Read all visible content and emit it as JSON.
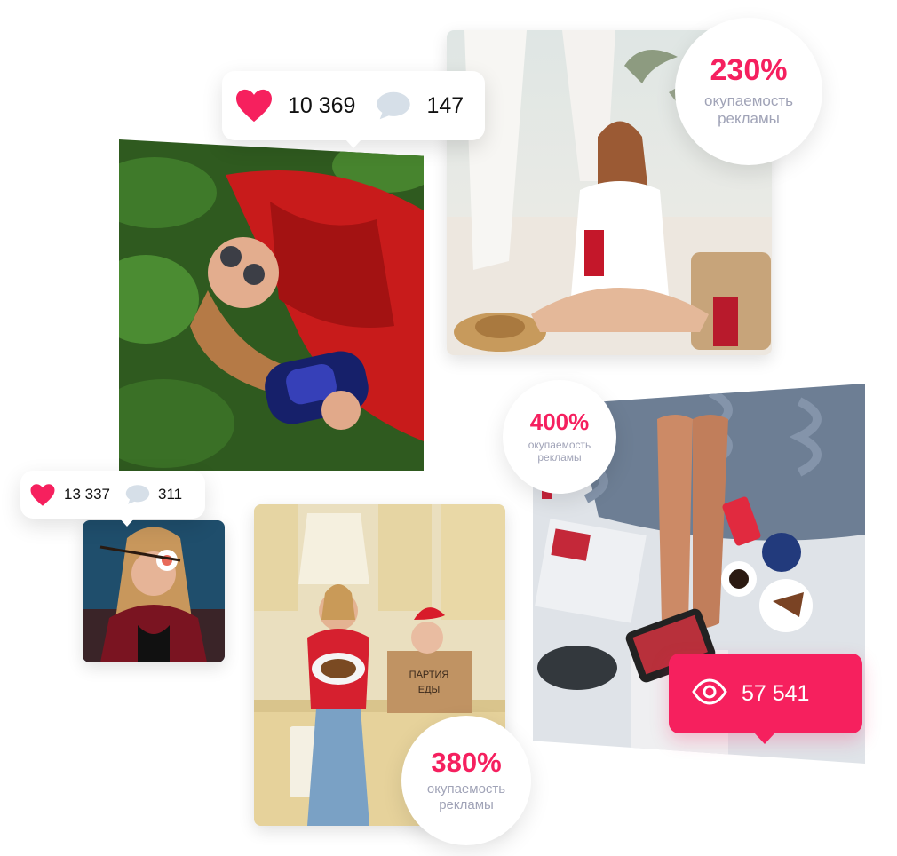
{
  "photos": {
    "beach": "beach-girl-photo",
    "grass": "red-shirt-girl-photo",
    "bed": "legs-on-bed-photo",
    "kitchen": "kitchen-woman-photo",
    "sushi": "sushi-girl-photo"
  },
  "stats_large": {
    "likes": "10 369",
    "comments": "147"
  },
  "stats_small": {
    "likes": "13 337",
    "comments": "311"
  },
  "roi": [
    {
      "value": "230%",
      "label": "окупаемость рекламы"
    },
    {
      "value": "400%",
      "label": "окупаемость рекламы"
    },
    {
      "value": "380%",
      "label": "окупаемость рекламы"
    }
  ],
  "views": {
    "count": "57 541"
  },
  "colors": {
    "accent": "#f6205e",
    "muted": "#a0a3b7",
    "comment_icon": "#d6dfe8"
  },
  "icons": {
    "like": "heart-icon",
    "comment": "comment-bubble-icon",
    "views": "eye-icon"
  }
}
